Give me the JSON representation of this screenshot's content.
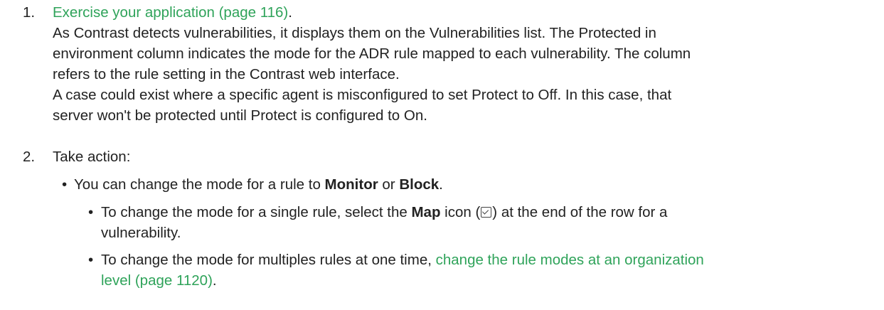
{
  "step1": {
    "number": "1.",
    "link": "Exercise your application (page 116)",
    "period": ".",
    "para1_lines": [
      "As Contrast detects vulnerabilities, it displays them on the Vulnerabilities list. The Protected in",
      "environment column indicates the mode for the ADR rule mapped to each vulnerability. The column",
      "refers to the rule setting in the Contrast web interface."
    ],
    "para2_lines": [
      "A case could exist where a specific agent is misconfigured to set Protect to Off. In this case, that",
      "server won't be protected until Protect is configured to On."
    ]
  },
  "step2": {
    "number": "2.",
    "text": "Take action:",
    "bullet1": {
      "dot": "•",
      "pre": "You can change the mode for a rule to ",
      "bold1": "Monitor",
      "mid": " or ",
      "bold2": "Block",
      "post": "."
    },
    "sub1": {
      "dot": "•",
      "pre": "To change the mode for a single rule, select the ",
      "bold": "Map",
      "icon_open": " icon (",
      "icon_name": "map-icon",
      "icon_close": ") at the end of the row for a",
      "line2": "vulnerability."
    },
    "sub2": {
      "dot": "•",
      "pre": "To change the mode for multiples rules at one time, ",
      "link_line1": "change the rule modes at an organization",
      "link_line2": "level (page 1120)",
      "post": "."
    }
  },
  "colors": {
    "link": "#2fa35a",
    "text": "#222222"
  }
}
